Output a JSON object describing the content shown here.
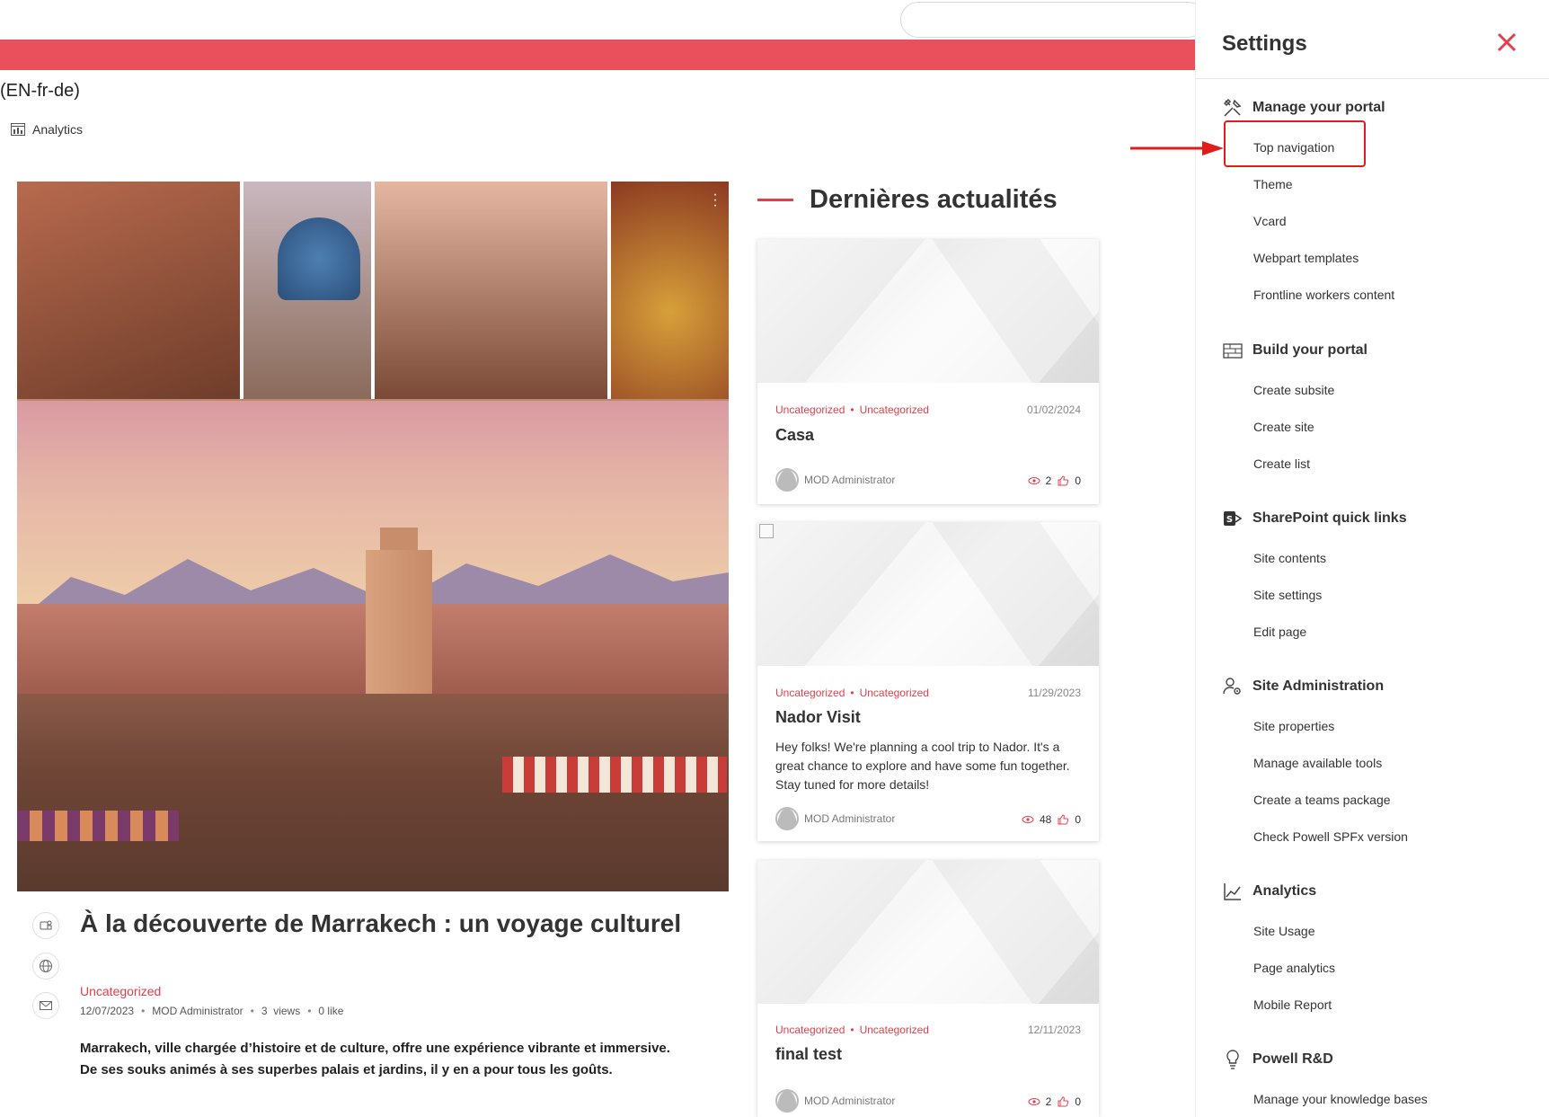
{
  "header": {
    "site_title": "(EN-fr-de)",
    "analytics_label": "Analytics",
    "search_placeholder": ""
  },
  "featured": {
    "title": "À la découverte de Marrakech : un voyage culturel",
    "category": "Uncategorized",
    "date": "12/07/2023",
    "author": "MOD Administrator",
    "views_count": "3",
    "views_label": "views",
    "likes_label": "0 like",
    "lead": "Marrakech, ville chargée d’histoire et de culture, offre une expérience vibrante et immersive. De ses souks animés à ses superbes palais et jardins, il y en a pour tous les goûts.",
    "share_icons": [
      "teams-icon",
      "globe-icon",
      "mail-icon"
    ]
  },
  "news": {
    "heading": "Dernières actualités",
    "cards": [
      {
        "categories": [
          "Uncategorized",
          "Uncategorized"
        ],
        "date": "01/02/2024",
        "title": "Casa",
        "excerpt": "",
        "author": "MOD Administrator",
        "views": "2",
        "likes": "0"
      },
      {
        "categories": [
          "Uncategorized",
          "Uncategorized"
        ],
        "date": "11/29/2023",
        "title": "Nador Visit",
        "excerpt": "Hey folks! We're planning a cool trip to Nador. It's a great chance to explore and have some fun together. Stay tuned for more details!",
        "author": "MOD Administrator",
        "views": "48",
        "likes": "0"
      },
      {
        "categories": [
          "Uncategorized",
          "Uncategorized"
        ],
        "date": "12/11/2023",
        "title": "final test",
        "excerpt": "",
        "author": "MOD Administrator",
        "views": "2",
        "likes": "0"
      }
    ]
  },
  "settings": {
    "title": "Settings",
    "close_icon": "close-icon",
    "sections": [
      {
        "title": "Manage your portal",
        "icon": "tools-icon",
        "items": [
          "Top navigation",
          "Theme",
          "Vcard",
          "Webpart templates",
          "Frontline workers content"
        ]
      },
      {
        "title": "Build your portal",
        "icon": "build-icon",
        "items": [
          "Create subsite",
          "Create site",
          "Create list"
        ]
      },
      {
        "title": "SharePoint quick links",
        "icon": "sharepoint-icon",
        "items": [
          "Site contents",
          "Site settings",
          "Edit page"
        ]
      },
      {
        "title": "Site Administration",
        "icon": "admin-user-icon",
        "items": [
          "Site properties",
          "Manage available tools",
          "Create a teams package",
          "Check Powell SPFx version"
        ]
      },
      {
        "title": "Analytics",
        "icon": "analytics-chart-icon",
        "items": [
          "Site Usage",
          "Page analytics",
          "Mobile Report"
        ]
      },
      {
        "title": "Powell R&D",
        "icon": "lightbulb-icon",
        "items": [
          "Manage your knowledge bases"
        ]
      }
    ]
  },
  "colors": {
    "accent": "#e9505c",
    "category_red": "#e0404c",
    "annotation_red": "#e21b1b"
  }
}
